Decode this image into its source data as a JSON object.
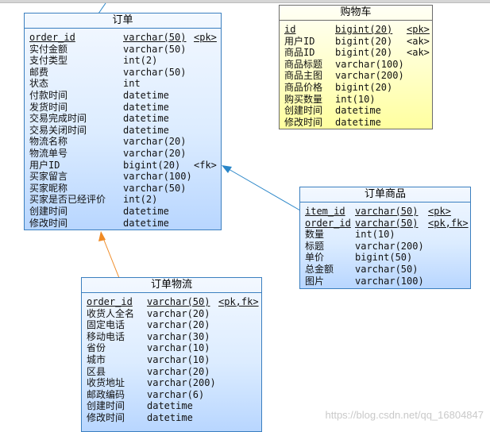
{
  "colors": {
    "entity_border": "#3b7fbf",
    "entity_fill": "#c7e0ff",
    "cart_fill": "#ffffb0",
    "link_blue": "#2a86c8",
    "link_orange": "#f08a24"
  },
  "entities": {
    "order": {
      "title": "订单",
      "rows": [
        {
          "name": "order_id",
          "type": "varchar(50)",
          "key": "<pk>",
          "underline": true
        },
        {
          "name": "实付金额",
          "type": "varchar(50)",
          "key": ""
        },
        {
          "name": "支付类型",
          "type": "int(2)",
          "key": ""
        },
        {
          "name": "邮费",
          "type": "varchar(50)",
          "key": ""
        },
        {
          "name": "状态",
          "type": "int",
          "key": ""
        },
        {
          "name": "付款时间",
          "type": "datetime",
          "key": ""
        },
        {
          "name": "发货时间",
          "type": "datetime",
          "key": ""
        },
        {
          "name": "交易完成时间",
          "type": "datetime",
          "key": ""
        },
        {
          "name": "交易关闭时间",
          "type": "datetime",
          "key": ""
        },
        {
          "name": "物流名称",
          "type": "varchar(20)",
          "key": ""
        },
        {
          "name": "物流单号",
          "type": "varchar(20)",
          "key": ""
        },
        {
          "name": "用户ID",
          "type": "bigint(20)",
          "key": "<fk>"
        },
        {
          "name": "买家留言",
          "type": "varchar(100)",
          "key": ""
        },
        {
          "name": "买家昵称",
          "type": "varchar(50)",
          "key": ""
        },
        {
          "name": "买家是否已经评价",
          "type": "int(2)",
          "key": ""
        },
        {
          "name": "创建时间",
          "type": "datetime",
          "key": ""
        },
        {
          "name": "修改时间",
          "type": "datetime",
          "key": ""
        }
      ]
    },
    "cart": {
      "title": "购物车",
      "rows": [
        {
          "name": "id",
          "type": "bigint(20)",
          "key": "<pk>",
          "underline": true
        },
        {
          "name": "用户ID",
          "type": "bigint(20)",
          "key": "<ak>"
        },
        {
          "name": "商品ID",
          "type": "bigint(20)",
          "key": "<ak>"
        },
        {
          "name": "商品标题",
          "type": "varchar(100)",
          "key": ""
        },
        {
          "name": "商品主图",
          "type": "varchar(200)",
          "key": ""
        },
        {
          "name": "商品价格",
          "type": "bigint(20)",
          "key": ""
        },
        {
          "name": "购买数量",
          "type": "int(10)",
          "key": ""
        },
        {
          "name": "创建时间",
          "type": "datetime",
          "key": ""
        },
        {
          "name": "修改时间",
          "type": "datetime",
          "key": ""
        }
      ]
    },
    "order_item": {
      "title": "订单商品",
      "rows": [
        {
          "name": "item_id",
          "type": "varchar(50)",
          "key": "<pk>",
          "underline": true
        },
        {
          "name": "order_id",
          "type": "varchar(50)",
          "key": "<pk,fk>",
          "underline": true
        },
        {
          "name": "数量",
          "type": "int(10)",
          "key": ""
        },
        {
          "name": "标题",
          "type": "varchar(200)",
          "key": ""
        },
        {
          "name": "单价",
          "type": "bigint(50)",
          "key": ""
        },
        {
          "name": "总金额",
          "type": "varchar(50)",
          "key": ""
        },
        {
          "name": "图片",
          "type": "varchar(100)",
          "key": ""
        }
      ]
    },
    "order_shipping": {
      "title": "订单物流",
      "rows": [
        {
          "name": "order_id",
          "type": "varchar(50)",
          "key": "<pk,fk>",
          "underline": true
        },
        {
          "name": "收货人全名",
          "type": "varchar(20)",
          "key": ""
        },
        {
          "name": "固定电话",
          "type": "varchar(20)",
          "key": ""
        },
        {
          "name": "移动电话",
          "type": "varchar(30)",
          "key": ""
        },
        {
          "name": "省份",
          "type": "varchar(10)",
          "key": ""
        },
        {
          "name": "城市",
          "type": "varchar(10)",
          "key": ""
        },
        {
          "name": "区县",
          "type": "varchar(20)",
          "key": ""
        },
        {
          "name": "收货地址",
          "type": "varchar(200)",
          "key": ""
        },
        {
          "name": "邮政编码",
          "type": "varchar(6)",
          "key": ""
        },
        {
          "name": "创建时间",
          "type": "datetime",
          "key": ""
        },
        {
          "name": "修改时间",
          "type": "datetime",
          "key": ""
        }
      ]
    }
  },
  "watermark": "https://blog.csdn.net/qq_16804847"
}
